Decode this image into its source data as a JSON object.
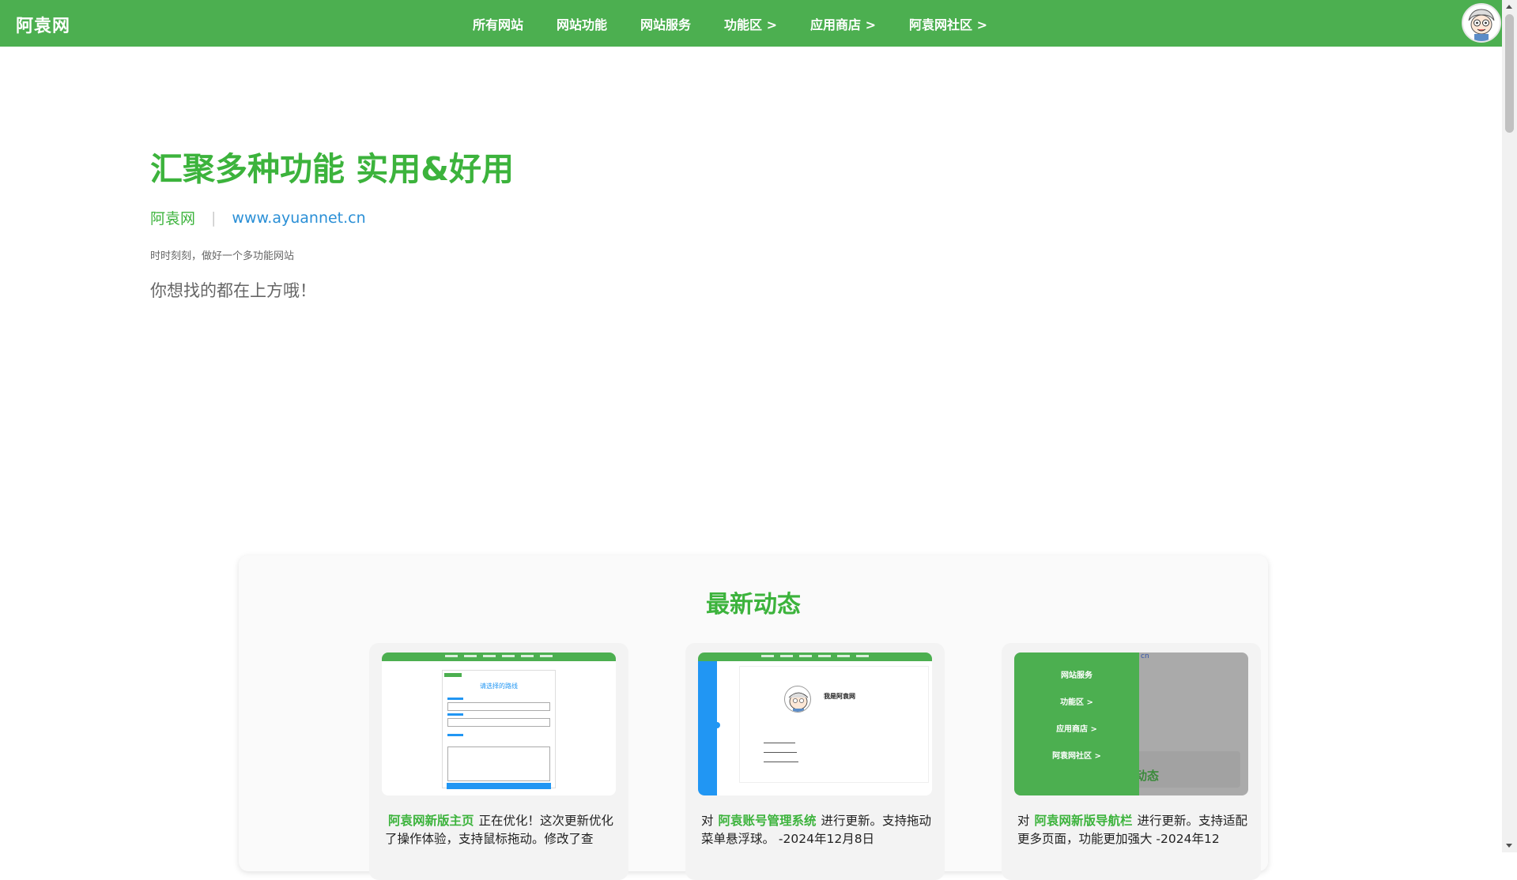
{
  "site": {
    "brand": "阿袁网"
  },
  "nav": {
    "items": [
      {
        "label": "所有网站"
      },
      {
        "label": "网站功能"
      },
      {
        "label": "网站服务"
      },
      {
        "label": "功能区 >"
      },
      {
        "label": "应用商店 >"
      },
      {
        "label": "阿袁网社区 >"
      }
    ]
  },
  "hero": {
    "title": "汇聚多种功能 实用&好用",
    "name": "阿袁网",
    "separator": "|",
    "url": "www.ayuannet.cn",
    "slogan": "时时刻刻，做好一个多功能网站",
    "hint": "你想找的都在上方哦！"
  },
  "news": {
    "title": "最新动态",
    "cards": [
      {
        "prefix": "",
        "highlight": "阿袁网新版主页",
        "text": "正在优化！这次更新优化了操作体验，支持鼠标拖动。修改了查"
      },
      {
        "prefix": "对",
        "highlight": "阿袁账号管理系统",
        "text": "进行更新。支持拖动菜单悬浮球。 -2024年12月8日"
      },
      {
        "prefix": "对",
        "highlight": "阿袁网新版导航栏",
        "text": "进行更新。支持适配更多页面，功能更加强大 -2024年12"
      }
    ],
    "thumb2_title": "我是阿袁网",
    "thumb3_menu": [
      "网站服务",
      "功能区 >",
      "应用商店 >",
      "阿袁网社区 >"
    ],
    "thumb3_under": "动态",
    "thumb3_cn": "cn",
    "thumb1_title": "请选择的路线"
  },
  "colors": {
    "brand_green": "#4caf50",
    "title_green": "#3cb33c",
    "link_blue": "#2a8fd6"
  },
  "icons": [
    "avatar-icon"
  ]
}
